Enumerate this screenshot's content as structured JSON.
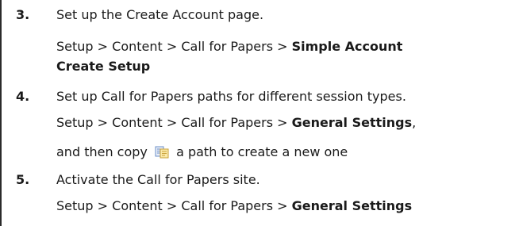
{
  "steps": [
    {
      "number": "3.",
      "title": "Set up the Create Account page.",
      "path_prefix": "Setup > Content > Call for Papers > ",
      "path_bold_1": "Simple Account",
      "path_bold_2": "Create Setup"
    },
    {
      "number": "4.",
      "title": "Set up Call for Papers paths for different session types.",
      "path_prefix": "Setup > Content > Call for Papers > ",
      "path_bold": "General Settings",
      "path_suffix": ",",
      "copy_before": "and then copy",
      "copy_icon": "copy-icon",
      "copy_after": "a path to create a new one"
    },
    {
      "number": "5.",
      "title": "Activate the Call for Papers site.",
      "path_prefix": "Setup > Content > Call for Papers > ",
      "path_bold": "General Settings"
    }
  ]
}
